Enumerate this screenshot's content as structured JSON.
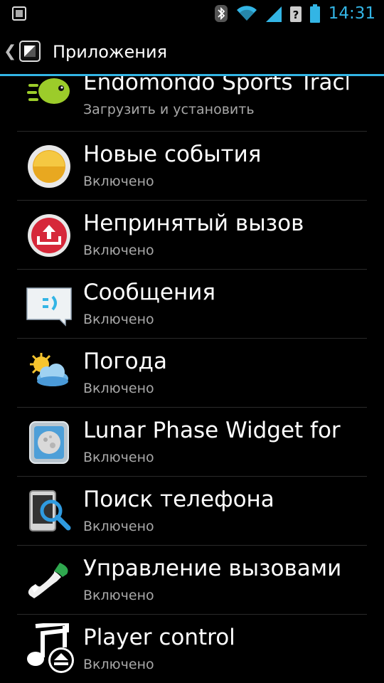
{
  "status_bar": {
    "time": "14:31",
    "icons": [
      "notification-icon",
      "bluetooth-icon",
      "wifi-icon",
      "signal-icon",
      "unknown-sim-icon",
      "battery-icon"
    ]
  },
  "action_bar": {
    "title": "Приложения",
    "up_icon": "chevron-left-icon",
    "app_icon": "settings-app-icon"
  },
  "apps": [
    {
      "title": "Endomondo Sports Track",
      "status": "Загрузить и установить",
      "icon": "endomondo-icon"
    },
    {
      "title": "Новые события",
      "status": "Включено",
      "icon": "new-events-icon"
    },
    {
      "title": "Непринятый вызов",
      "status": "Включено",
      "icon": "missed-call-icon"
    },
    {
      "title": "Сообщения",
      "status": "Включено",
      "icon": "messages-icon"
    },
    {
      "title": "Погода",
      "status": "Включено",
      "icon": "weather-icon"
    },
    {
      "title": "Lunar Phase Widget for S",
      "status": "Включено",
      "icon": "lunar-phase-icon"
    },
    {
      "title": "Поиск телефона",
      "status": "Включено",
      "icon": "find-phone-icon"
    },
    {
      "title": "Управление вызовами",
      "status": "Включено",
      "icon": "call-control-icon"
    },
    {
      "title": "Player control",
      "status": "Включено",
      "icon": "player-control-icon"
    }
  ]
}
